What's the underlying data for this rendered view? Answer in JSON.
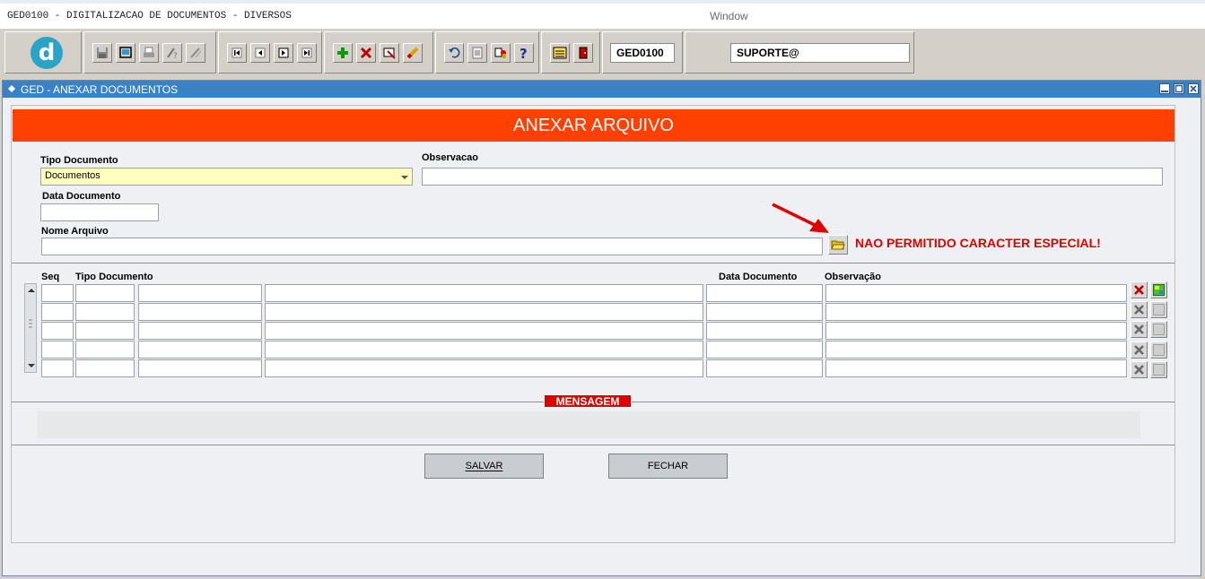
{
  "app": {
    "title": "GED0100 - DIGITALIZACAO DE DOCUMENTOS - DIVERSOS",
    "window_menu": "Window"
  },
  "toolbar": {
    "logo_letter": "d",
    "module_code": "GED0100",
    "user": "SUPORTE@",
    "icons": [
      "save-icon",
      "print-preview-icon",
      "print-icon",
      "query-help-icon",
      "query-tool-icon",
      "first-record-icon",
      "previous-record-icon",
      "next-record-icon",
      "last-record-icon",
      "insert-record-icon",
      "delete-record-icon",
      "edit-record-icon",
      "clear-icon",
      "undo-icon",
      "copy-icon",
      "keys-icon",
      "help-icon",
      "menu-icon",
      "exit-icon"
    ]
  },
  "window": {
    "title": "GED - ANEXAR DOCUMENTOS"
  },
  "form": {
    "banner": "ANEXAR ARQUIVO",
    "tipo_documento_label": "Tipo Documento",
    "tipo_documento_value": "Documentos",
    "observacao_label": "Observacao",
    "observacao_value": "",
    "data_documento_label": "Data Documento",
    "data_documento_value": "",
    "nome_arquivo_label": "Nome Arquivo",
    "nome_arquivo_value": "",
    "warning": "NAO PERMITIDO CARACTER ESPECIAL!"
  },
  "grid": {
    "headers": {
      "seq": "Seq",
      "tipo_documento": "Tipo Documento",
      "data_documento": "Data Documento",
      "observacao": "Observação"
    },
    "rows": [
      {
        "seq": "",
        "tipo": "",
        "tipo_desc": "",
        "nome": "",
        "data": "",
        "obs": ""
      },
      {
        "seq": "",
        "tipo": "",
        "tipo_desc": "",
        "nome": "",
        "data": "",
        "obs": ""
      },
      {
        "seq": "",
        "tipo": "",
        "tipo_desc": "",
        "nome": "",
        "data": "",
        "obs": ""
      },
      {
        "seq": "",
        "tipo": "",
        "tipo_desc": "",
        "nome": "",
        "data": "",
        "obs": ""
      },
      {
        "seq": "",
        "tipo": "",
        "tipo_desc": "",
        "nome": "",
        "data": "",
        "obs": ""
      }
    ]
  },
  "message": {
    "title": "MENSAGEM",
    "text": ""
  },
  "buttons": {
    "salvar": "SALVAR",
    "fechar": "FECHAR"
  },
  "colors": {
    "banner": "#ff4000",
    "warning": "#e00000",
    "titlebar": "#3a82c4",
    "current_row": "#ffffc0"
  }
}
